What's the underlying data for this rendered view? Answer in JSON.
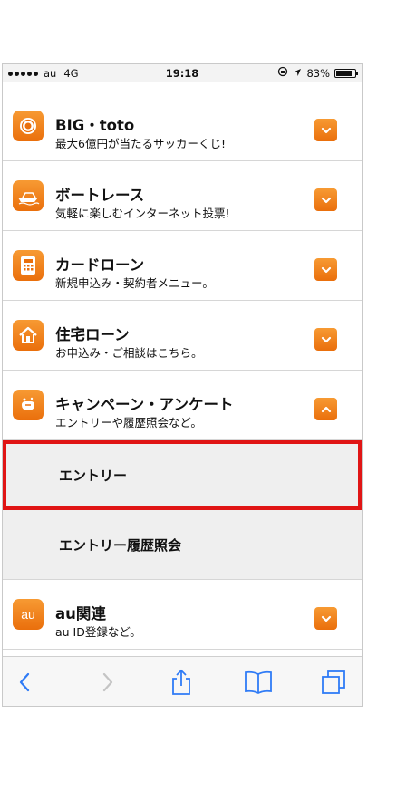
{
  "status_bar": {
    "carrier": "au",
    "network": "4G",
    "time": "19:18",
    "battery": "83%",
    "battery_level": 0.83
  },
  "menu": [
    {
      "title": "BIG・toto",
      "subtitle": "最大6億円が当たるサッカーくじ!",
      "icon": "soccer-ball-icon",
      "expanded": false
    },
    {
      "title": "ボートレース",
      "subtitle": "気軽に楽しむインターネット投票!",
      "icon": "boat-icon",
      "expanded": false
    },
    {
      "title": "カードローン",
      "subtitle": "新規申込み・契約者メニュー。",
      "icon": "calculator-icon",
      "expanded": false
    },
    {
      "title": "住宅ローン",
      "subtitle": "お申込み・ご相談はこちら。",
      "icon": "house-icon",
      "expanded": false
    },
    {
      "title": "キャンペーン・アンケート",
      "subtitle": "エントリーや履歴照会など。",
      "icon": "campaign-icon",
      "expanded": true
    }
  ],
  "submenu": {
    "entry": "エントリー",
    "history": "エントリー履歴照会"
  },
  "au_row": {
    "title": "au関連",
    "subtitle": "au ID登録など。",
    "icon": "au-logo-icon",
    "icon_text": "au"
  },
  "colors": {
    "accent": "#f08a24",
    "highlight": "#e01515"
  }
}
